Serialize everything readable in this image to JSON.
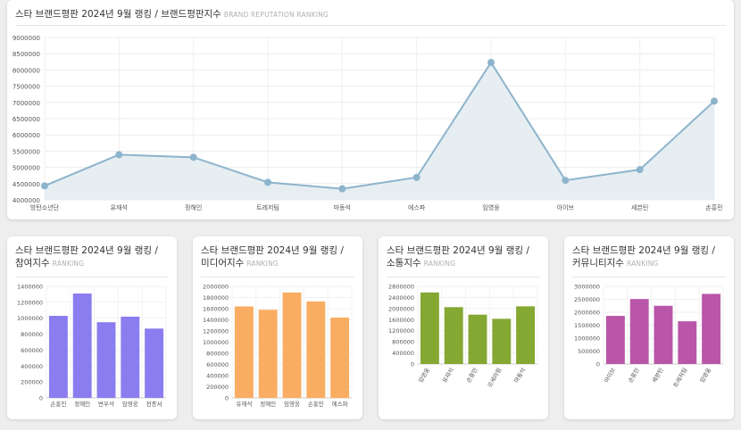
{
  "main": {
    "title": "스타 브랜드평판 2024년 9월 랭킹 / 브랜드평판지수",
    "subtitle": "BRAND REPUTATION RANKING"
  },
  "cards": [
    {
      "title": "스타 브랜드평판 2024년 9월 랭킹 / 참여지수",
      "subtitle": "RANKING"
    },
    {
      "title": "스타 브랜드평판 2024년 9월 랭킹 / 미디어지수",
      "subtitle": "RANKING"
    },
    {
      "title": "스타 브랜드평판 2024년 9월 랭킹 / 소통지수",
      "subtitle": "RANKING"
    },
    {
      "title": "스타 브랜드평판 2024년 9월 랭킹 / 커뮤니티지수",
      "subtitle": "RANKING"
    }
  ],
  "chart_data": [
    {
      "type": "area",
      "title": "스타 브랜드평판 2024년 9월 랭킹 / 브랜드평판지수",
      "categories": [
        "방탄소년단",
        "유재석",
        "정해인",
        "트레저팀",
        "마동석",
        "에스파",
        "임영웅",
        "아이브",
        "세븐틴",
        "손흥민"
      ],
      "values": [
        4430000,
        5390000,
        5310000,
        4540000,
        4340000,
        4690000,
        8230000,
        4600000,
        4930000,
        7040000
      ],
      "ylim": [
        4000000,
        9000000
      ],
      "yticks": [
        "4000000",
        "4500000",
        "5000000",
        "5500000",
        "6000000",
        "6500000",
        "7000000",
        "7500000",
        "8000000",
        "8500000",
        "9000000"
      ],
      "color": "#8db4cc",
      "fill": "#e6eef2",
      "grid": true
    },
    {
      "type": "bar",
      "title": "스타 브랜드평판 2024년 9월 랭킹 / 참여지수",
      "categories": [
        "손흥민",
        "정해인",
        "변우석",
        "임영웅",
        "전종서"
      ],
      "values": [
        1030000,
        1310000,
        950000,
        1020000,
        870000
      ],
      "ylim": [
        0,
        1400000
      ],
      "yticks": [
        "0",
        "200000",
        "400000",
        "600000",
        "800000",
        "1000000",
        "1200000",
        "1400000"
      ],
      "color": "#8b7cf0",
      "rotate": false
    },
    {
      "type": "bar",
      "title": "스타 브랜드평판 2024년 9월 랭킹 / 미디어지수",
      "categories": [
        "유재석",
        "정해인",
        "임영웅",
        "손흥민",
        "에스파"
      ],
      "values": [
        1640000,
        1580000,
        1890000,
        1730000,
        1440000
      ],
      "ylim": [
        0,
        2000000
      ],
      "yticks": [
        "0",
        "200000",
        "400000",
        "600000",
        "800000",
        "1000000",
        "1200000",
        "1400000",
        "1600000",
        "1800000",
        "2000000"
      ],
      "color": "#f9ad62",
      "rotate": false
    },
    {
      "type": "bar",
      "title": "스타 브랜드평판 2024년 9월 랭킹 / 소통지수",
      "categories": [
        "임영웅",
        "유재석",
        "손흥민",
        "르세라핌",
        "마동석"
      ],
      "values": [
        2580000,
        2050000,
        1780000,
        1630000,
        2080000
      ],
      "ylim": [
        0,
        2800000
      ],
      "yticks": [
        "0",
        "400000",
        "800000",
        "1200000",
        "1600000",
        "2000000",
        "2400000",
        "2800000"
      ],
      "color": "#84a832",
      "rotate": true
    },
    {
      "type": "bar",
      "title": "스타 브랜드평판 2024년 9월 랭킹 / 커뮤니티지수",
      "categories": [
        "아이브",
        "손흥민",
        "세븐틴",
        "트레저팀",
        "임영웅"
      ],
      "values": [
        1860000,
        2510000,
        2250000,
        1650000,
        2710000
      ],
      "ylim": [
        0,
        3000000
      ],
      "yticks": [
        "0",
        "500000",
        "1000000",
        "1500000",
        "2000000",
        "2500000",
        "3000000"
      ],
      "color": "#b956a8",
      "rotate": true
    }
  ]
}
